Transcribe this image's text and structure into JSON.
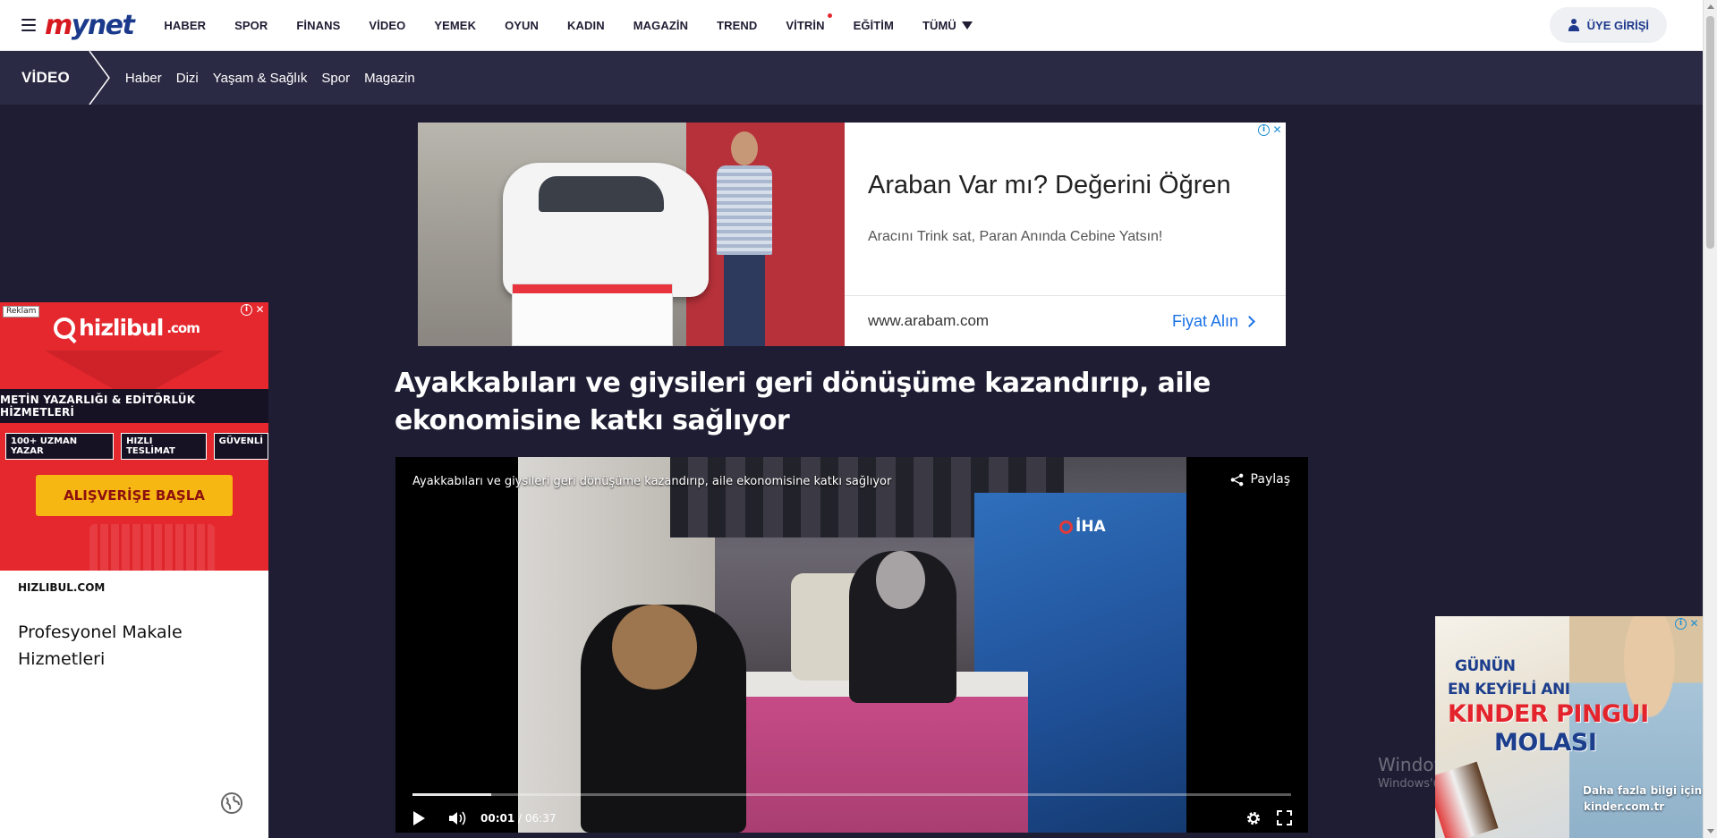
{
  "nav": {
    "logo": "mynet",
    "items": [
      "HABER",
      "SPOR",
      "FİNANS",
      "VİDEO",
      "YEMEK",
      "OYUN",
      "KADIN",
      "MAGAZİN",
      "TREND",
      "VİTRİN",
      "EĞİTİM"
    ],
    "more_label": "TÜMÜ",
    "login_label": "ÜYE GİRİŞİ"
  },
  "subnav": {
    "section": "VİDEO",
    "items": [
      "Haber",
      "Dizi",
      "Yaşam & Sağlık",
      "Spor",
      "Magazin"
    ]
  },
  "top_ad": {
    "headline": "Araban Var mı? Değerini Öğren",
    "description": "Aracını Trink sat, Paran Anında Cebine Yatsın!",
    "url": "www.arabam.com",
    "cta": "Fiyat Alın"
  },
  "article": {
    "title": "Ayakkabıları ve giysileri geri dönüşüme kazandırıp, aile ekonomisine katkı sağlıyor"
  },
  "video": {
    "overlay_title": "Ayakkabıları ve giysileri geri dönüşüme kazandırıp, aile ekonomisine katkı sağlıyor",
    "share_label": "Paylaş",
    "watermark": "İHA",
    "current_time": "00:01",
    "duration": "06:37",
    "buffered_fraction": 0.09
  },
  "side_ad": {
    "label": "Reklam",
    "brand": "hizlibul",
    "brand_suffix": ".com",
    "headline": "METİN YAZARLIĞI & EDİTÖRLÜK HİZMETLERİ",
    "tags": [
      "100+ UZMAN YAZAR",
      "HIZLI TESLİMAT",
      "GÜVENLİ"
    ],
    "cta": "ALIŞVERİŞE BAŞLA",
    "site": "HIZLIBUL.COM",
    "copy": "Profesyonel Makale Hizmetleri"
  },
  "corner_ad": {
    "line1": "GÜNÜN",
    "line2": "EN KEYİFLİ ANI",
    "line3": "KINDER PINGUI",
    "line4": "MOLASI",
    "more": "Daha fazla bilgi için",
    "url": "kinder.com.tr"
  },
  "os_watermark": {
    "line1": "Windows'u Etkinleştir",
    "line2": "Windows'u etkinleştirmek için Ayarlar'a gidin."
  },
  "colors": {
    "page_bg": "#1f1d33",
    "subnav_bg": "#2b2a44",
    "brand_blue": "#1b3a8c",
    "brand_red": "#d71a21",
    "link_blue": "#1a73e8"
  }
}
